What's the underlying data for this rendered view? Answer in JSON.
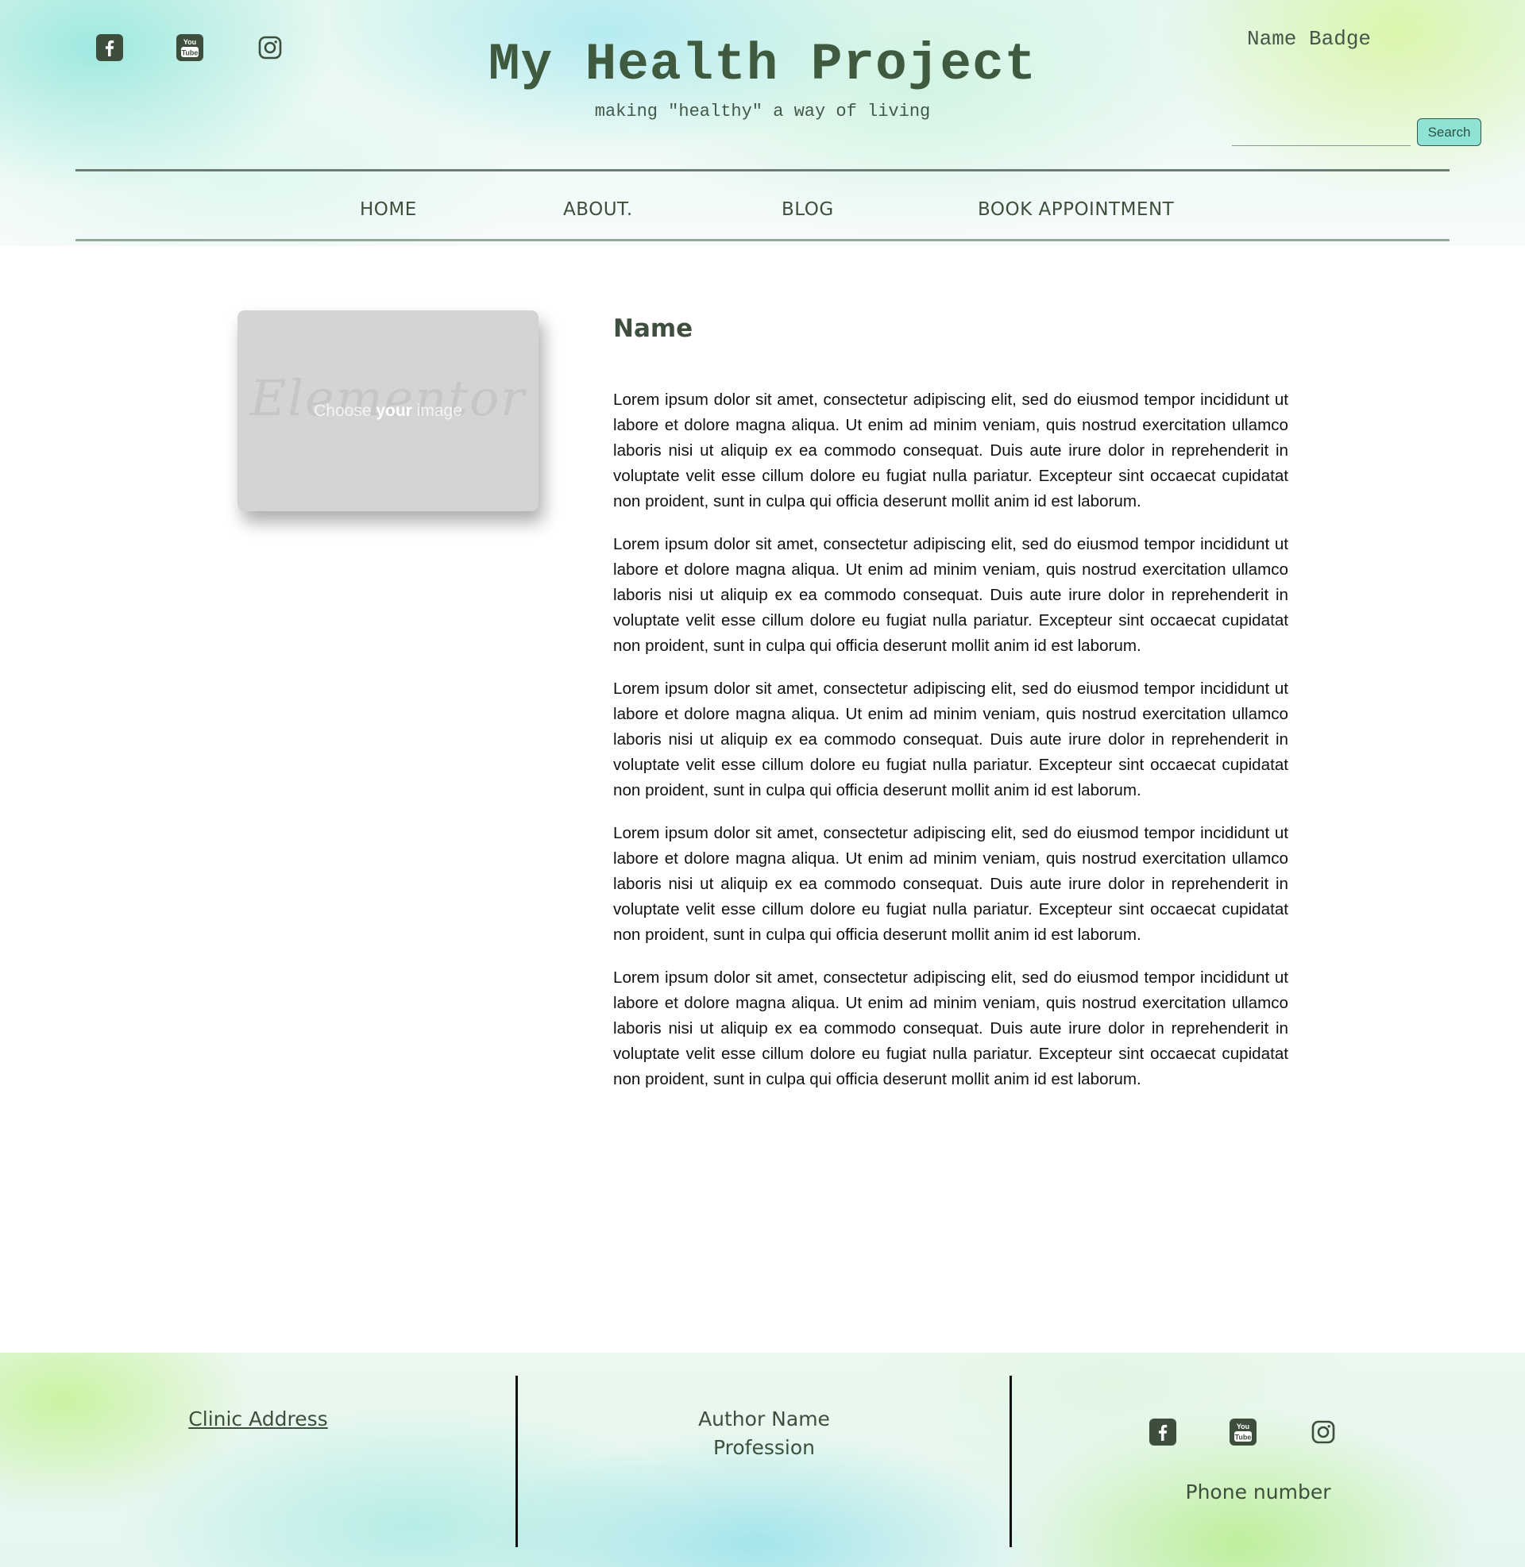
{
  "header": {
    "title": "My Health Project",
    "tagline": "making \"healthy\" a way of living",
    "badge": "Name Badge",
    "search": {
      "value": "",
      "button_label": "Search"
    },
    "social_icons": [
      "facebook-icon",
      "youtube-icon",
      "instagram-icon"
    ]
  },
  "nav": {
    "items": [
      {
        "label": "HOME"
      },
      {
        "label": "ABOUT."
      },
      {
        "label": "BLOG"
      },
      {
        "label": "BOOK APPOINTMENT"
      }
    ]
  },
  "main": {
    "image_placeholder": {
      "watermark": "Elementor",
      "prefix": "Choose ",
      "emphasis": "your",
      "suffix": " image"
    },
    "name": "Name",
    "paragraphs": [
      "Lorem ipsum dolor sit amet, consectetur adipiscing elit, sed do eiusmod tempor incididunt ut labore et dolore magna aliqua. Ut enim ad minim veniam, quis nostrud exercitation ullamco laboris nisi ut aliquip ex ea commodo consequat. Duis aute irure dolor in reprehenderit in voluptate velit esse cillum dolore eu fugiat nulla pariatur. Excepteur sint occaecat cupidatat non proident, sunt in culpa qui officia deserunt mollit anim id est laborum.",
      "Lorem ipsum dolor sit amet, consectetur adipiscing elit, sed do eiusmod tempor incididunt ut labore et dolore magna aliqua. Ut enim ad minim veniam, quis nostrud exercitation ullamco laboris nisi ut aliquip ex ea commodo consequat. Duis aute irure dolor in reprehenderit in voluptate velit esse cillum dolore eu fugiat nulla pariatur. Excepteur sint occaecat cupidatat non proident, sunt in culpa qui officia deserunt mollit anim id est laborum.",
      "Lorem ipsum dolor sit amet, consectetur adipiscing elit, sed do eiusmod tempor incididunt ut labore et dolore magna aliqua. Ut enim ad minim veniam, quis nostrud exercitation ullamco laboris nisi ut aliquip ex ea commodo consequat. Duis aute irure dolor in reprehenderit in voluptate velit esse cillum dolore eu fugiat nulla pariatur. Excepteur sint occaecat cupidatat non proident, sunt in culpa qui officia deserunt mollit anim id est laborum.",
      "Lorem ipsum dolor sit amet, consectetur adipiscing elit, sed do eiusmod tempor incididunt ut labore et dolore magna aliqua. Ut enim ad minim veniam, quis nostrud exercitation ullamco laboris nisi ut aliquip ex ea commodo consequat. Duis aute irure dolor in reprehenderit in voluptate velit esse cillum dolore eu fugiat nulla pariatur. Excepteur sint occaecat cupidatat non proident, sunt in culpa qui officia deserunt mollit anim id est laborum.",
      "Lorem ipsum dolor sit amet, consectetur adipiscing elit, sed do eiusmod tempor incididunt ut labore et dolore magna aliqua. Ut enim ad minim veniam, quis nostrud exercitation ullamco laboris nisi ut aliquip ex ea commodo consequat. Duis aute irure dolor in reprehenderit in voluptate velit esse cillum dolore eu fugiat nulla pariatur. Excepteur sint occaecat cupidatat non proident, sunt in culpa qui officia deserunt mollit anim id est laborum."
    ]
  },
  "footer": {
    "clinic_address": "Clinic Address",
    "author_name": "Author Name",
    "profession": "Profession",
    "phone": "Phone number",
    "social_icons": [
      "facebook-icon",
      "youtube-icon",
      "instagram-icon"
    ]
  },
  "colors": {
    "icon": "#3d4f3c",
    "title": "#3f5a3f",
    "search_button": "#8fe3d4",
    "nav_text": "#3d4f3c"
  }
}
